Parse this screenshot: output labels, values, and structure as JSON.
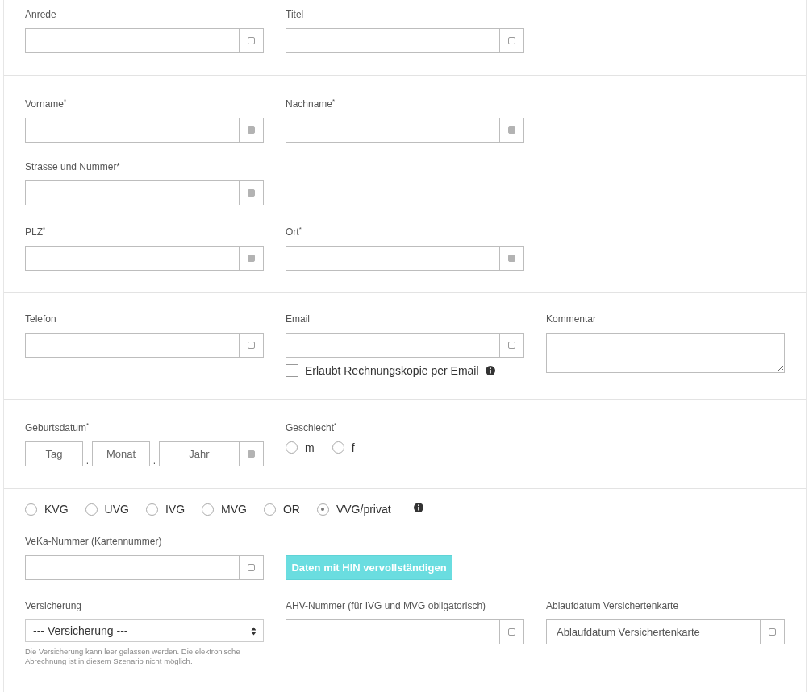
{
  "sections": [
    {
      "rows": [
        [
          {
            "kind": "field",
            "label": "Anrede",
            "required": false
          },
          {
            "kind": "field",
            "label": "Titel",
            "required": false
          }
        ]
      ]
    },
    {
      "rows": [
        [
          {
            "kind": "field",
            "label": "Vorname$^{*}$",
            "required": true
          },
          {
            "kind": "field",
            "label": "Nachname$^{*}$",
            "required": true
          }
        ],
        [
          {
            "kind": "field",
            "label": "Strasse und Nummer*",
            "required": true
          }
        ],
        [
          {
            "kind": "field",
            "label": "PLZ$^{*}$",
            "required": true
          },
          {
            "kind": "field",
            "label": "Ort$^{*}$",
            "required": true
          }
        ]
      ]
    },
    {
      "rows": [
        [
          {
            "kind": "field",
            "label": "Telefon",
            "required": false
          },
          {
            "kind": "field",
            "label": "Email",
            "required": false,
            "option": {
              "label": "Erlaubt Rechnungskopie per Email",
              "checked": false,
              "info": true
            }
          },
          {
            "kind": "textarea",
            "label": "Kommentar"
          }
        ]
      ]
    },
    {
      "rows": [
        [
          {
            "kind": "date",
            "label": "Geburtsdatum$^{*}$",
            "required": true,
            "parts": [
              {
                "placeholder": "Tag"
              },
              {
                "placeholder": "Monat"
              },
              {
                "placeholder": "Jahr"
              }
            ],
            "separator": "."
          },
          {
            "kind": "radios",
            "label": "Geschlecht$^{*}$",
            "options": [
              {
                "label": "m",
                "selected": false
              },
              {
                "label": "f",
                "selected": false
              }
            ]
          }
        ]
      ]
    },
    {
      "rows": [
        [
          {
            "kind": "choices",
            "info": true,
            "options": [
              {
                "label": "KVG",
                "selected": false
              },
              {
                "label": "UVG",
                "selected": false
              },
              {
                "label": "IVG",
                "selected": false
              },
              {
                "label": "MVG",
                "selected": false
              },
              {
                "label": "OR",
                "selected": false
              },
              {
                "label": "VVG/privat",
                "selected": true
              }
            ]
          }
        ],
        [
          {
            "kind": "field",
            "label": "VeKa-Nummer (Kartennummer)",
            "required": false
          },
          {
            "kind": "button",
            "label": "Daten mit HIN vervollständigen"
          }
        ],
        [
          {
            "kind": "select",
            "label": "Versicherung",
            "value": "--- Versicherung ---",
            "help": "Die Versicherung kann leer gelassen werden. Die elektronische Abrechnung ist in diesem Szenario nicht möglich."
          },
          {
            "kind": "field",
            "label": "AHV-Nummer (für IVG und MVG obligatorisch)",
            "required": false
          },
          {
            "kind": "field",
            "label": "Ablaufdatum Versichertenkarte",
            "required": false,
            "placeholder": "Ablaufdatum Versichertenkarte"
          }
        ]
      ]
    }
  ]
}
